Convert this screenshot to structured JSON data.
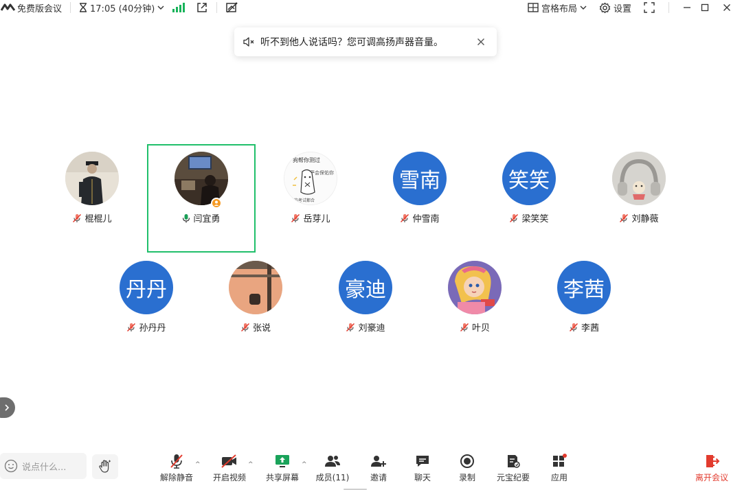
{
  "topbar": {
    "plan": "免费版会议",
    "time": "17:05 (40分钟)",
    "layout_label": "宫格布局",
    "settings_label": "设置"
  },
  "toast": {
    "message": "听不到他人说话吗？您可调高扬声器音量。"
  },
  "participants": [
    {
      "name": "棍棍儿",
      "avatar_type": "photo",
      "muted": true
    },
    {
      "name": "闫宜勇",
      "avatar_type": "photo",
      "muted": false,
      "speaking": true,
      "host": true,
      "active": true
    },
    {
      "name": "岳芽儿",
      "avatar_type": "photo",
      "muted": true
    },
    {
      "name": "仲雪南",
      "avatar_type": "text",
      "avatar_text": "雪南",
      "muted": true
    },
    {
      "name": "梁笑笑",
      "avatar_type": "text",
      "avatar_text": "笑笑",
      "muted": true
    },
    {
      "name": "刘静薇",
      "avatar_type": "photo",
      "muted": true
    },
    {
      "name": "孙丹丹",
      "avatar_type": "text",
      "avatar_text": "丹丹",
      "muted": true
    },
    {
      "name": "张说",
      "avatar_type": "photo",
      "muted": true
    },
    {
      "name": "刘豪迪",
      "avatar_type": "text",
      "avatar_text": "豪迪",
      "muted": true
    },
    {
      "name": "叶贝",
      "avatar_type": "photo",
      "muted": true
    },
    {
      "name": "李茜",
      "avatar_type": "text",
      "avatar_text": "李茜",
      "muted": true
    }
  ],
  "avatar_texts": {
    "yueyaer_sticker": "狗帮你测过",
    "yueyaer_sticker_2": "普萨会保佑你",
    "yueyaer_sticker_3": "的考试都合"
  },
  "chat_input": {
    "placeholder": "说点什么..."
  },
  "toolbar": {
    "unmute": "解除静音",
    "video": "开启视频",
    "share": "共享屏幕",
    "members": "成员(11)",
    "invite": "邀请",
    "chat": "聊天",
    "record": "录制",
    "summary": "元宝纪要",
    "apps": "应用",
    "leave": "离开会议"
  },
  "colors": {
    "accent_green": "#1fbf6a",
    "avatar_blue": "#2a6fd0",
    "leave_red": "#e23b2e",
    "host_badge": "#f59a23"
  }
}
